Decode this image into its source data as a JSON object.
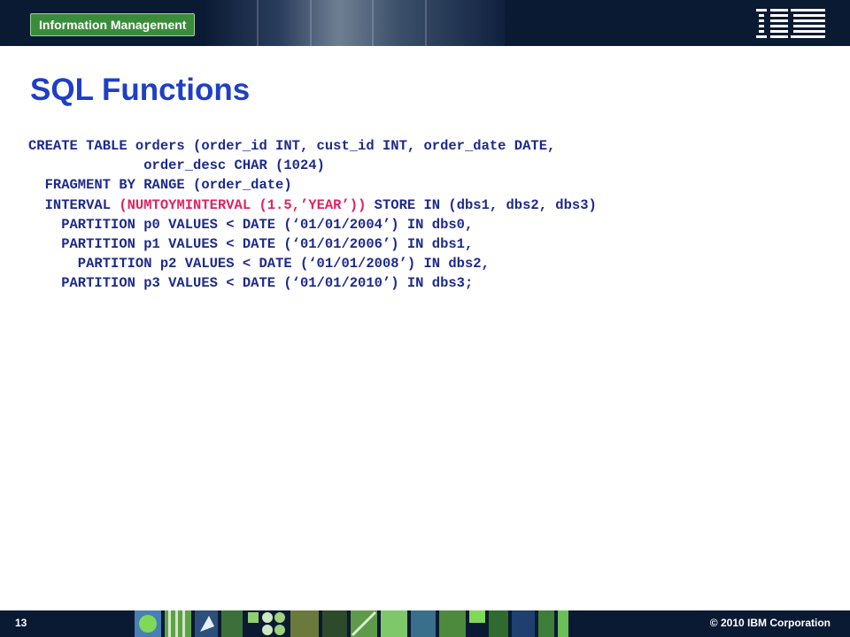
{
  "header": {
    "brand_label": "Information Management",
    "logo_text": "IBM",
    "colors": {
      "bar": "#0b1a33",
      "badge": "#3a8c3a"
    }
  },
  "slide": {
    "title": "SQL Functions",
    "title_color": "#1f3fc4",
    "code_color": "#1d2a8c",
    "highlight_color": "#e0235e",
    "code_lines": [
      {
        "text": "CREATE TABLE orders (order_id INT, cust_id INT, order_date DATE,"
      },
      {
        "text": "              order_desc CHAR (1024)"
      },
      {
        "text": "  FRAGMENT BY RANGE (order_date)"
      },
      {
        "pre": "  INTERVAL ",
        "highlight": "(NUMTOYMINTERVAL (1.5,’YEAR’))",
        "post": " STORE IN (dbs1, dbs2, dbs3)"
      },
      {
        "text": "    PARTITION p0 VALUES < DATE (‘01/01/2004’) IN dbs0,"
      },
      {
        "text": "    PARTITION p1 VALUES < DATE (‘01/01/2006’) IN dbs1,"
      },
      {
        "text": "      PARTITION p2 VALUES < DATE (‘01/01/2008’) IN dbs2,"
      },
      {
        "text": "    PARTITION p3 VALUES < DATE (‘01/01/2010’) IN dbs3;"
      }
    ]
  },
  "footer": {
    "page_number": "13",
    "copyright": "© 2010 IBM Corporation"
  }
}
